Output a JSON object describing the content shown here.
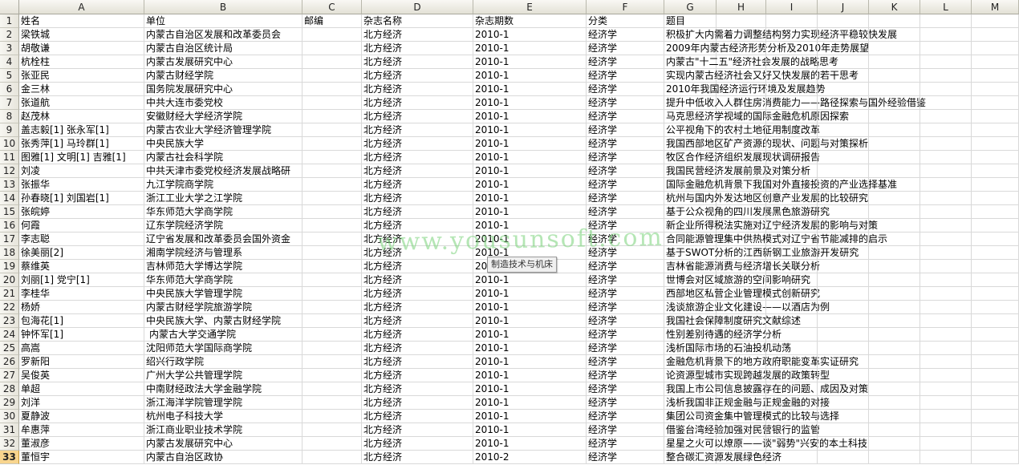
{
  "columns": [
    "A",
    "B",
    "C",
    "D",
    "E",
    "F",
    "G",
    "H",
    "I",
    "J",
    "K",
    "L",
    "M"
  ],
  "rows": [
    [
      "姓名",
      "单位",
      "邮编",
      "杂志名称",
      "杂志期数",
      "分类",
      "题目"
    ],
    [
      "梁铁城",
      "内蒙古自治区发展和改革委员会",
      "",
      "北方经济",
      "2010-1",
      "经济学",
      "积极扩大内需着力调整结构努力实现经济平稳较快发展"
    ],
    [
      "胡敬谦",
      "内蒙古自治区统计局",
      "",
      "北方经济",
      "2010-1",
      "经济学",
      "2009年内蒙古经济形势分析及2010年走势展望"
    ],
    [
      "杭栓柱",
      "内蒙古发展研究中心",
      "",
      "北方经济",
      "2010-1",
      "经济学",
      "内蒙古\"十二五\"经济社会发展的战略思考"
    ],
    [
      "张亚民",
      "内蒙古财经学院",
      "",
      "北方经济",
      "2010-1",
      "经济学",
      "实现内蒙古经济社会又好又快发展的若干思考"
    ],
    [
      "金三林",
      "国务院发展研究中心",
      "",
      "北方经济",
      "2010-1",
      "经济学",
      "2010年我国经济运行环境及发展趋势"
    ],
    [
      "张道航",
      "中共大连市委党校",
      "",
      "北方经济",
      "2010-1",
      "经济学",
      "提升中低收入人群住房消费能力——路径探索与国外经验借鉴"
    ],
    [
      "赵茂林",
      "安徽财经大学经济学院",
      "",
      "北方经济",
      "2010-1",
      "经济学",
      "马克思经济学视域的国际金融危机原因探索"
    ],
    [
      "盖志毅[1] 张永军[1]",
      "内蒙古农业大学经济管理学院",
      "",
      "北方经济",
      "2010-1",
      "经济学",
      "公平视角下的农村土地征用制度改革"
    ],
    [
      "张秀萍[1] 马玲群[1]",
      "中央民族大学",
      "",
      "北方经济",
      "2010-1",
      "经济学",
      "我国西部地区矿产资源的现状、问题与对策探析"
    ],
    [
      "图雅[1] 文明[1] 吉雅[1]",
      "内蒙古社会科学院",
      "",
      "北方经济",
      "2010-1",
      "经济学",
      "牧区合作经济组织发展现状调研报告"
    ],
    [
      "刘凌",
      "中共天津市委党校经济发展战略研",
      "",
      "北方经济",
      "2010-1",
      "经济学",
      "我国民营经济发展前景及对策分析"
    ],
    [
      "张振华",
      "九江学院商学院",
      "",
      "北方经济",
      "2010-1",
      "经济学",
      "国际金融危机背景下我国对外直接投资的产业选择基准"
    ],
    [
      "孙春晓[1] 刘国岩[1]",
      "浙江工业大学之江学院",
      "",
      "北方经济",
      "2010-1",
      "经济学",
      "杭州与国内外发达地区创意产业发展的比较研究"
    ],
    [
      "张皖婷",
      "华东师范大学商学院",
      "",
      "北方经济",
      "2010-1",
      "经济学",
      "基于公众视角的四川发展黑色旅游研究"
    ],
    [
      "何霞",
      "辽东学院经济学院",
      "",
      "北方经济",
      "2010-1",
      "经济学",
      "新企业所得税法实施对辽宁经济发展的影响与对策"
    ],
    [
      "李志聪",
      "辽宁省发展和改革委员会国外资金",
      "",
      "北方经济",
      "2010-1",
      "经济学",
      "合同能源管理集中供热模式对辽宁省节能减排的启示"
    ],
    [
      "徐美丽[2]",
      "湘南学院经济与管理系",
      "",
      "北方经济",
      "2010-1",
      "经济学",
      "基于SWOT分析的江西新钢工业旅游开发研究"
    ],
    [
      "蔡维英",
      "吉林师范大学博达学院",
      "",
      "北方经济",
      "2010-1",
      "经济学",
      "吉林省能源消费与经济增长关联分析"
    ],
    [
      "刘丽[1] 党宁[1]",
      "华东师范大学商学院",
      "",
      "北方经济",
      "2010-1",
      "经济学",
      "世博会对区域旅游的空间影响研究"
    ],
    [
      "李桂华",
      "中央民族大学管理学院",
      "",
      "北方经济",
      "2010-1",
      "经济学",
      "西部地区私营企业管理模式创新研究"
    ],
    [
      "杨娇",
      "内蒙古财经学院旅游学院",
      "",
      "北方经济",
      "2010-1",
      "经济学",
      "浅谈旅游企业文化建设——以酒店为例"
    ],
    [
      "包海花[1]",
      "中央民族大学、内蒙古财经学院",
      "",
      "北方经济",
      "2010-1",
      "经济学",
      "我国社会保障制度研究文献综述"
    ],
    [
      "钟怀军[1]",
      "内蒙古大学交通学院",
      "",
      "北方经济",
      "2010-1",
      "经济学",
      "性别差别待遇的经济学分析"
    ],
    [
      "高嵩",
      "沈阳师范大学国际商学院",
      "",
      "北方经济",
      "2010-1",
      "经济学",
      "浅析国际市场的石油投机动荡"
    ],
    [
      "罗新阳",
      "绍兴行政学院",
      "",
      "北方经济",
      "2010-1",
      "经济学",
      "金融危机背景下的地方政府职能变革实证研究"
    ],
    [
      "吴俊英",
      "广州大学公共管理学院",
      "",
      "北方经济",
      "2010-1",
      "经济学",
      "论资源型城市实现跨越发展的政策转型"
    ],
    [
      "单超",
      "中南财经政法大学金融学院",
      "",
      "北方经济",
      "2010-1",
      "经济学",
      "我国上市公司信息披露存在的问题、成因及对策"
    ],
    [
      "刘洋",
      "浙江海洋学院管理学院",
      "",
      "北方经济",
      "2010-1",
      "经济学",
      "浅析我国非正规金融与正规金融的对接"
    ],
    [
      "夏静波",
      "杭州电子科技大学",
      "",
      "北方经济",
      "2010-1",
      "经济学",
      "集团公司资金集中管理模式的比较与选择"
    ],
    [
      "牟惠萍",
      "浙江商业职业技术学院",
      "",
      "北方经济",
      "2010-1",
      "经济学",
      "借鉴台湾经验加强对民营银行的监管"
    ],
    [
      "董淑彦",
      "内蒙古发展研究中心",
      "",
      "北方经济",
      "2010-1",
      "经济学",
      "星星之火可以燎原——谈\"弱势\"兴安的本土科技"
    ],
    [
      "董恒宇",
      "内蒙古自治区政协",
      "",
      "北方经济",
      "2010-2",
      "经济学",
      "整合碳汇资源发展绿色经济"
    ]
  ],
  "active_row": 33,
  "watermark": "www.yousunsoft.com",
  "tooltip": "制造技术与机床"
}
